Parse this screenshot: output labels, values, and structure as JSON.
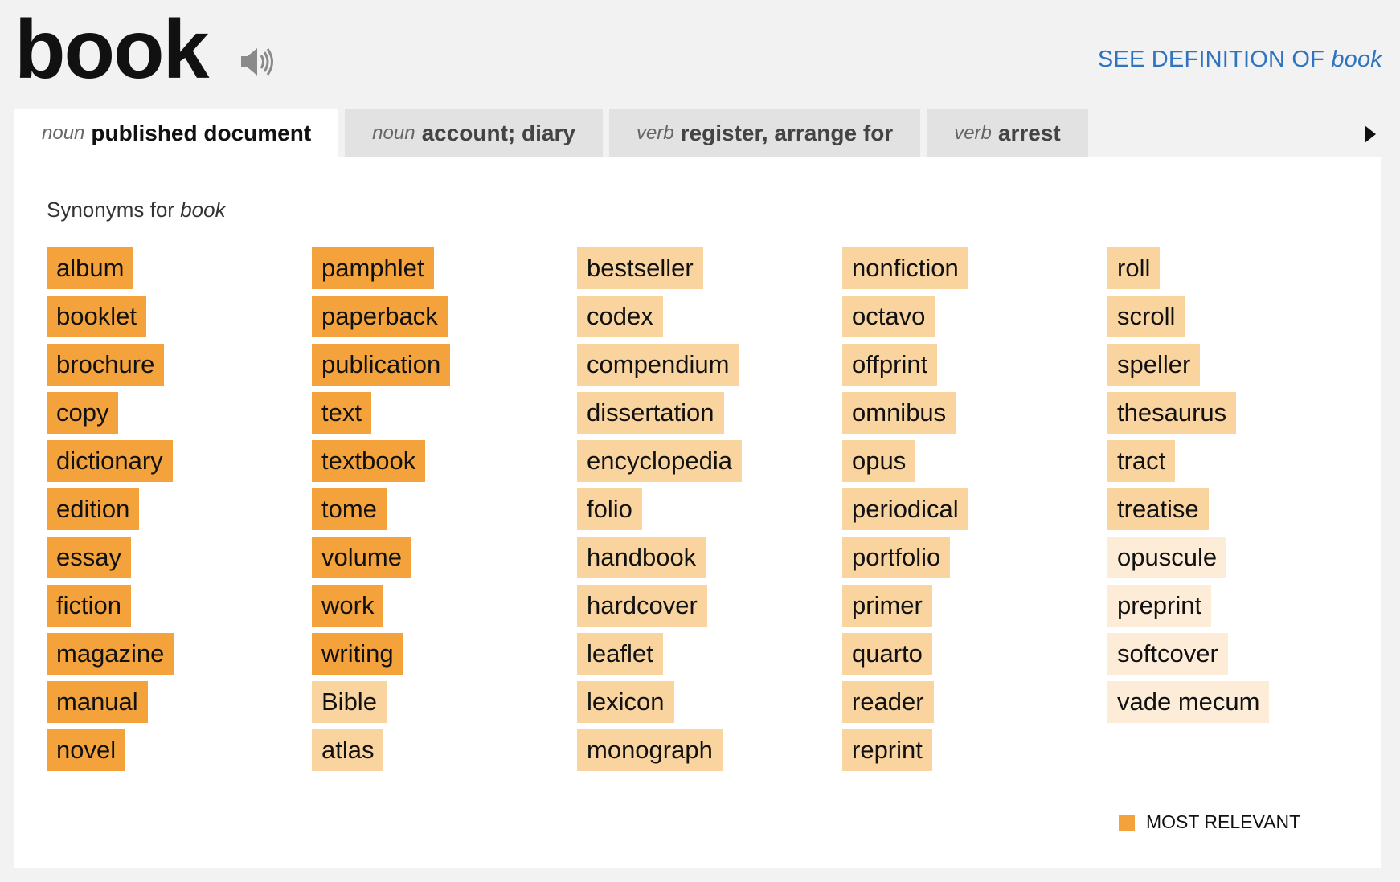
{
  "header": {
    "word": "book",
    "see_definition_label": "SEE DEFINITION OF",
    "see_definition_word": "book"
  },
  "tabs": [
    {
      "pos": "noun",
      "sense": "published document",
      "active": true
    },
    {
      "pos": "noun",
      "sense": "account; diary",
      "active": false
    },
    {
      "pos": "verb",
      "sense": "register, arrange for",
      "active": false
    },
    {
      "pos": "verb",
      "sense": "arrest",
      "active": false
    }
  ],
  "synonyms": {
    "heading_prefix": "Synonyms for",
    "heading_word": "book",
    "columns": [
      [
        {
          "word": "album",
          "relevance": 3
        },
        {
          "word": "booklet",
          "relevance": 3
        },
        {
          "word": "brochure",
          "relevance": 3
        },
        {
          "word": "copy",
          "relevance": 3
        },
        {
          "word": "dictionary",
          "relevance": 3
        },
        {
          "word": "edition",
          "relevance": 3
        },
        {
          "word": "essay",
          "relevance": 3
        },
        {
          "word": "fiction",
          "relevance": 3
        },
        {
          "word": "magazine",
          "relevance": 3
        },
        {
          "word": "manual",
          "relevance": 3
        },
        {
          "word": "novel",
          "relevance": 3
        }
      ],
      [
        {
          "word": "pamphlet",
          "relevance": 3
        },
        {
          "word": "paperback",
          "relevance": 3
        },
        {
          "word": "publication",
          "relevance": 3
        },
        {
          "word": "text",
          "relevance": 3
        },
        {
          "word": "textbook",
          "relevance": 3
        },
        {
          "word": "tome",
          "relevance": 3
        },
        {
          "word": "volume",
          "relevance": 3
        },
        {
          "word": "work",
          "relevance": 3
        },
        {
          "word": "writing",
          "relevance": 3
        },
        {
          "word": "Bible",
          "relevance": 2
        },
        {
          "word": "atlas",
          "relevance": 2
        }
      ],
      [
        {
          "word": "bestseller",
          "relevance": 2
        },
        {
          "word": "codex",
          "relevance": 2
        },
        {
          "word": "compendium",
          "relevance": 2
        },
        {
          "word": "dissertation",
          "relevance": 2
        },
        {
          "word": "encyclopedia",
          "relevance": 2
        },
        {
          "word": "folio",
          "relevance": 2
        },
        {
          "word": "handbook",
          "relevance": 2
        },
        {
          "word": "hardcover",
          "relevance": 2
        },
        {
          "word": "leaflet",
          "relevance": 2
        },
        {
          "word": "lexicon",
          "relevance": 2
        },
        {
          "word": "monograph",
          "relevance": 2
        }
      ],
      [
        {
          "word": "nonfiction",
          "relevance": 2
        },
        {
          "word": "octavo",
          "relevance": 2
        },
        {
          "word": "offprint",
          "relevance": 2
        },
        {
          "word": "omnibus",
          "relevance": 2
        },
        {
          "word": "opus",
          "relevance": 2
        },
        {
          "word": "periodical",
          "relevance": 2
        },
        {
          "word": "portfolio",
          "relevance": 2
        },
        {
          "word": "primer",
          "relevance": 2
        },
        {
          "word": "quarto",
          "relevance": 2
        },
        {
          "word": "reader",
          "relevance": 2
        },
        {
          "word": "reprint",
          "relevance": 2
        }
      ],
      [
        {
          "word": "roll",
          "relevance": 2
        },
        {
          "word": "scroll",
          "relevance": 2
        },
        {
          "word": "speller",
          "relevance": 2
        },
        {
          "word": "thesaurus",
          "relevance": 2
        },
        {
          "word": "tract",
          "relevance": 2
        },
        {
          "word": "treatise",
          "relevance": 2
        },
        {
          "word": "opuscule",
          "relevance": 1
        },
        {
          "word": "preprint",
          "relevance": 1
        },
        {
          "word": "softcover",
          "relevance": 1
        },
        {
          "word": "vade mecum",
          "relevance": 1
        }
      ]
    ]
  },
  "legend": {
    "label": "MOST RELEVANT",
    "color": "#f4a33c"
  },
  "colors": {
    "most_relevant": "#f4a33c",
    "relevant": "#f9d49f",
    "less_relevant": "#fdecd8",
    "link": "#2f74c0"
  },
  "icons": {
    "speaker": "speaker-icon",
    "tab_scroll": "triangle-right-icon"
  }
}
